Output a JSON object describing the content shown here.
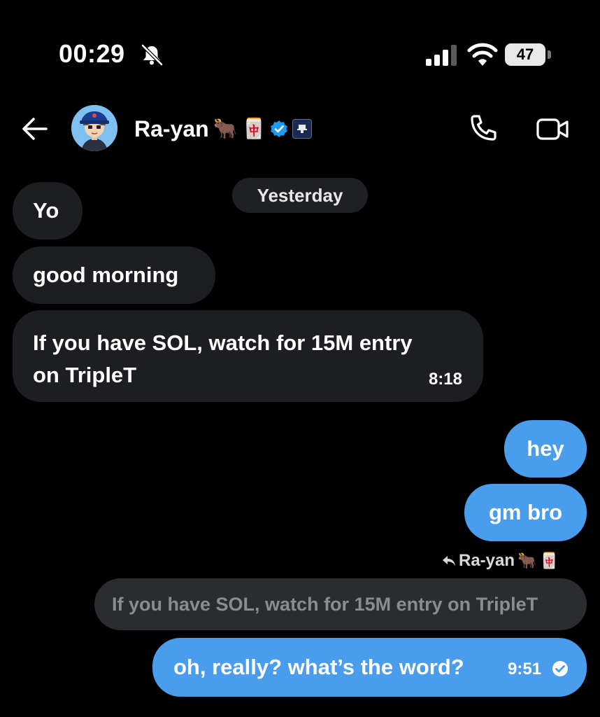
{
  "status_bar": {
    "time": "00:29",
    "battery": "47",
    "icons": [
      "bell-slash-icon",
      "cellular-signal-icon",
      "wifi-icon",
      "battery-icon"
    ]
  },
  "header": {
    "contact_name": "Ra-yan",
    "name_emojis": [
      "🐂",
      "🀄"
    ],
    "icons": [
      "back-arrow-icon",
      "verified-badge-icon",
      "affiliate-badge-icon",
      "phone-icon",
      "video-icon"
    ]
  },
  "conversation": {
    "date_divider": "Yesterday",
    "incoming": [
      {
        "text": "Yo"
      },
      {
        "text": "good morning"
      },
      {
        "text_line1": "If you have SOL, watch for 15M entry",
        "text_line2": "on TripleT",
        "time": "8:18"
      }
    ],
    "outgoing": [
      {
        "text": "hey"
      },
      {
        "text": "gm bro"
      }
    ],
    "reply": {
      "to_name": "Ra-yan",
      "to_emojis": [
        "🐂",
        "🀄"
      ],
      "quoted_text": "If you have SOL, watch for 15M entry on TripleT",
      "text": "oh, really? what’s the word?",
      "time": "9:51"
    }
  },
  "colors": {
    "background": "#000000",
    "incoming_bubble": "#1c1e21",
    "outgoing_bubble": "#4a9cec",
    "quoted_bubble": "#2a2c30",
    "verified": "#1d9bf0"
  }
}
